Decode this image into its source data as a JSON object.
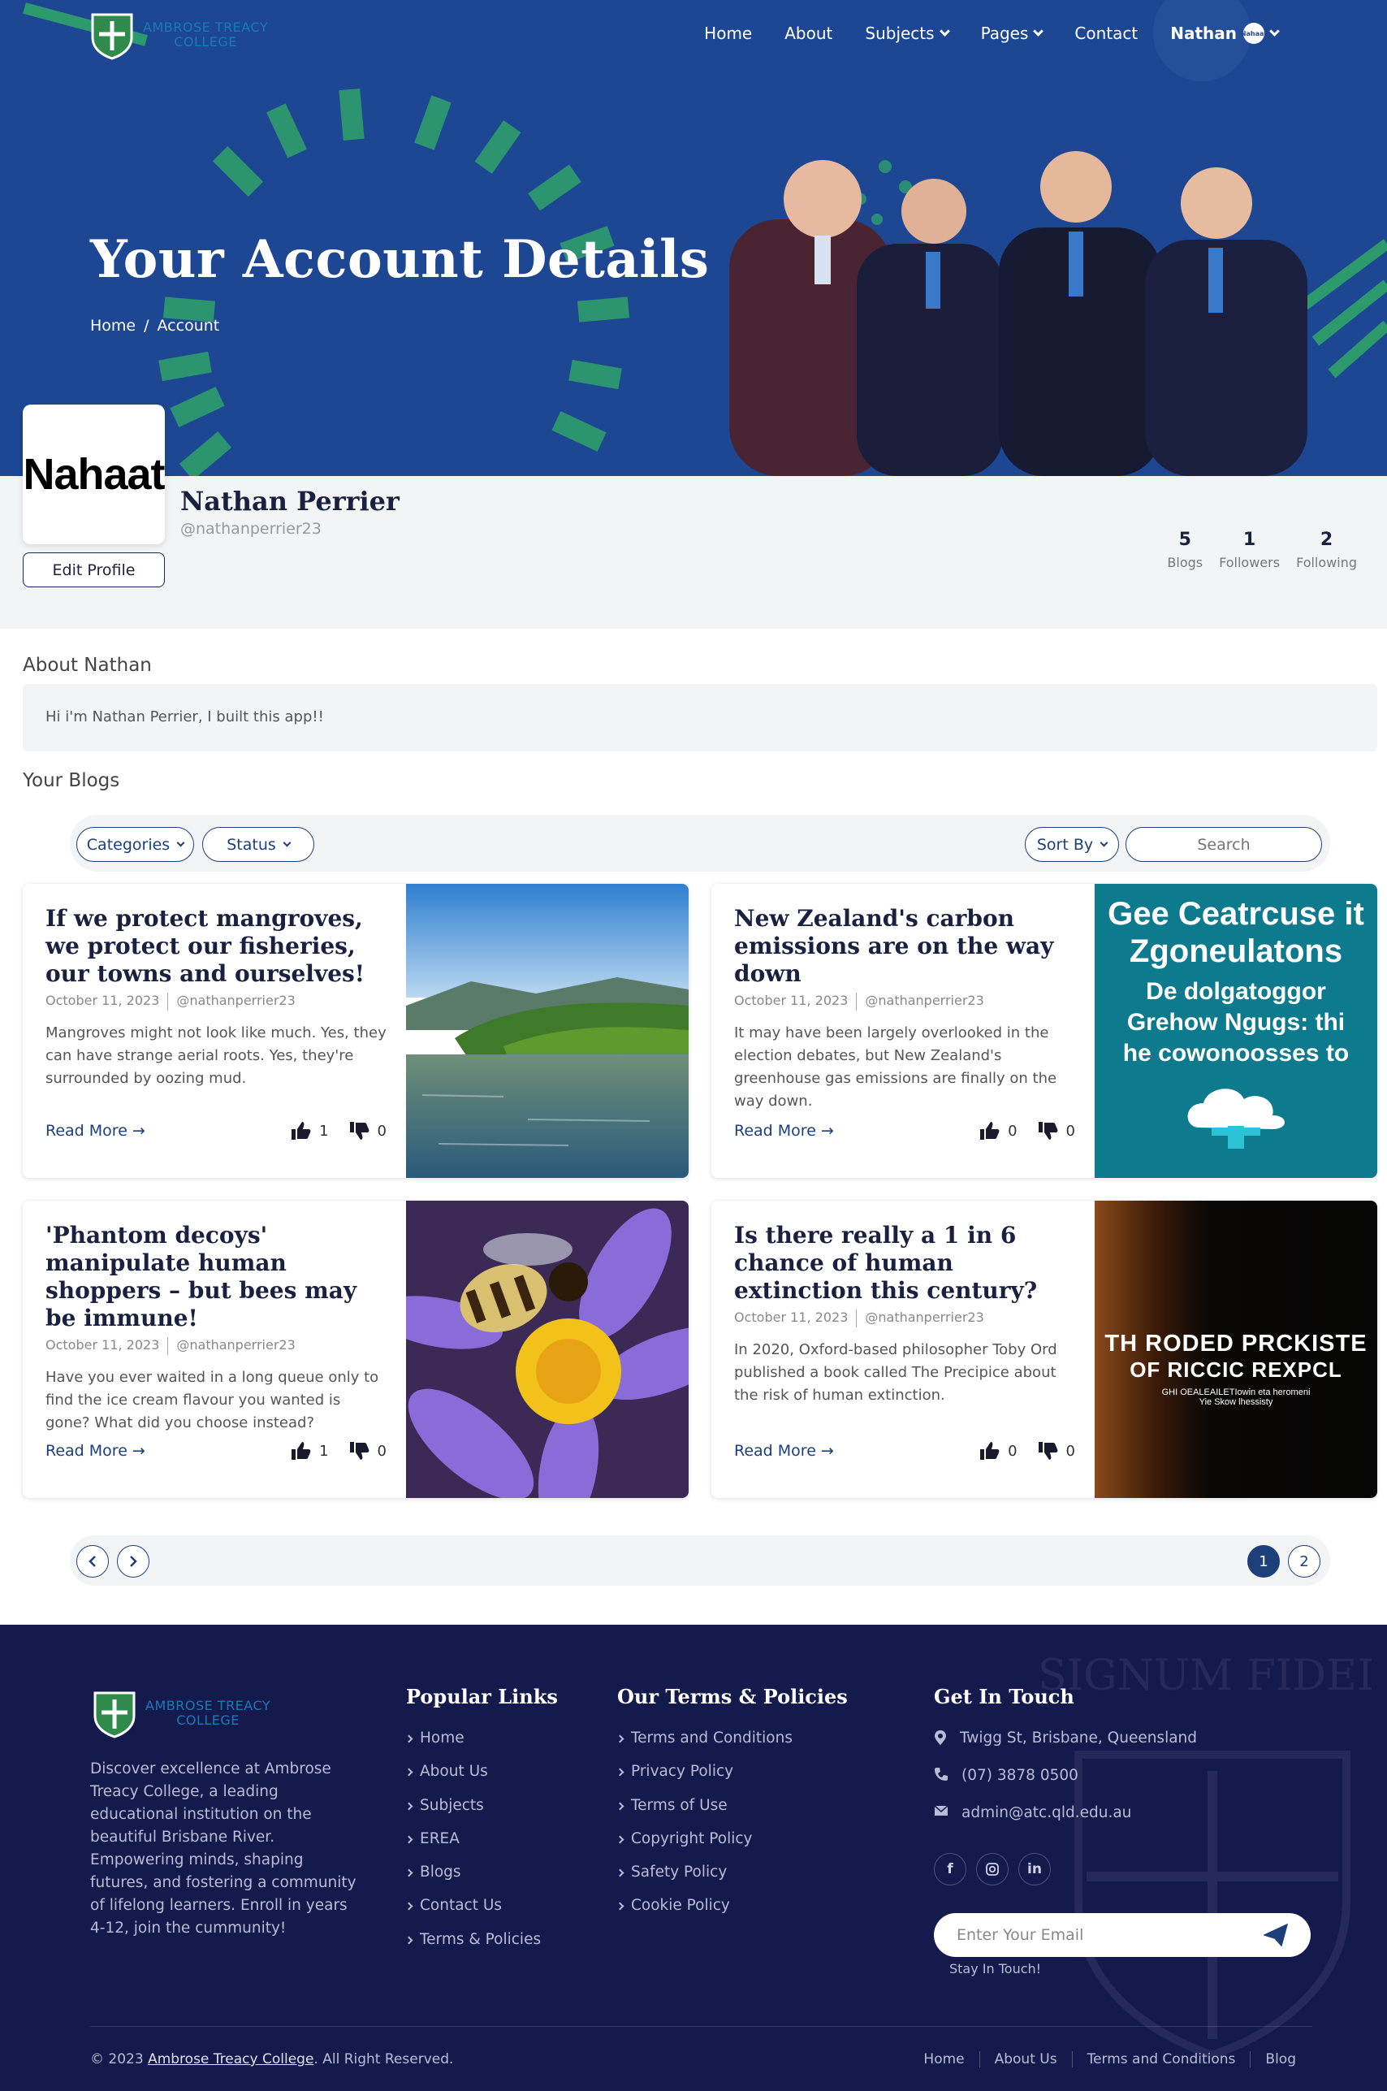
{
  "brand": {
    "logo_line1": "AMBROSE TREACY",
    "logo_line2": "COLLEGE"
  },
  "nav": {
    "items": [
      "Home",
      "About",
      "Subjects",
      "Pages",
      "Contact"
    ],
    "user": "Nathan",
    "user_avatar": "Nahaat"
  },
  "hero": {
    "title": "Your Account Details",
    "crumb_home": "Home",
    "crumb_sep": "/",
    "crumb_current": "Account"
  },
  "profile": {
    "avatar_text": "Nahaat",
    "name": "Nathan Perrier",
    "handle": "@nathanperrier23",
    "edit_label": "Edit Profile",
    "stats": [
      {
        "value": "5",
        "label": "Blogs"
      },
      {
        "value": "1",
        "label": "Followers"
      },
      {
        "value": "2",
        "label": "Following"
      }
    ]
  },
  "about": {
    "title": "About Nathan",
    "text": "Hi i'm Nathan Perrier, I built this app!!"
  },
  "blogs": {
    "title": "Your Blogs",
    "filters": {
      "categories": "Categories",
      "status": "Status",
      "sort": "Sort By",
      "search_placeholder": "Search"
    },
    "read_more": "Read More →",
    "posts": [
      {
        "title": "If we protect mangroves, we protect our fisheries, our towns and ourselves!",
        "date": "October 11, 2023",
        "author": "@nathanperrier23",
        "excerpt": "Mangroves might not look like much. Yes, they can have strange aerial roots. Yes, they're surrounded by oozing mud.",
        "likes": "1",
        "dislikes": "0"
      },
      {
        "title": "New Zealand's carbon emissions are on the way down",
        "date": "October 11, 2023",
        "author": "@nathanperrier23",
        "excerpt": "It may have been largely overlooked in the election debates, but New Zealand's greenhouse gas emissions are finally on the way down.",
        "likes": "0",
        "dislikes": "0",
        "image_text": [
          "Gee Ceatrcuse it",
          "Zgoneulatons",
          "De dolgatoggor",
          "Grehow Ngugs: thi",
          "he cowonoosses to"
        ]
      },
      {
        "title": "'Phantom decoys' manipulate human shoppers – but bees may be immune!",
        "date": "October 11, 2023",
        "author": "@nathanperrier23",
        "excerpt": "Have you ever waited in a long queue only to find the ice cream flavour you wanted is gone? What did you choose instead?",
        "likes": "1",
        "dislikes": "0"
      },
      {
        "title": "Is there really a 1 in 6 chance of human extinction this century?",
        "date": "October 11, 2023",
        "author": "@nathanperrier23",
        "excerpt": "In 2020, Oxford-based philosopher Toby Ord published a book called The Precipice about the risk of human extinction.",
        "likes": "0",
        "dislikes": "0",
        "image_text": [
          "TH RODED PRCKISTE",
          "OF RICCIC REXPCL",
          "GHI OEALEAILETIowin eta heromeni",
          "Yie Skow lhessisty"
        ]
      }
    ]
  },
  "pagination": {
    "pages": [
      "1",
      "2"
    ],
    "current": "1"
  },
  "footer": {
    "description": "Discover excellence at Ambrose Treacy College, a leading educational institution on the beautiful Brisbane River. Empowering minds, shaping futures, and fostering a community of lifelong learners. Enroll in years 4-12, join the cummunity!",
    "popular_title": "Popular Links",
    "popular_links": [
      "Home",
      "About Us",
      "Subjects",
      "EREA",
      "Blogs",
      "Contact Us",
      "Terms & Policies"
    ],
    "terms_title": "Our Terms & Policies",
    "terms_links": [
      "Terms and Conditions",
      "Privacy Policy",
      "Terms of Use",
      "Copyright Policy",
      "Safety Policy",
      "Cookie Policy"
    ],
    "contact_title": "Get In Touch",
    "address": "Twigg St, Brisbane, Queensland",
    "phone": "(07) 3878 0500",
    "email": "admin@atc.qld.edu.au",
    "email_placeholder": "Enter Your Email",
    "stay_label": "Stay In Touch!",
    "copyright_prefix": "© 2023",
    "copyright_link": "Ambrose Treacy College",
    "copyright_suffix": ". All Right Reserved.",
    "bottom_links": [
      "Home",
      "About Us",
      "Terms and Conditions",
      "Blog"
    ],
    "crest_text": "SIGNUM FIDEI"
  },
  "colors": {
    "primary": "#1d4793",
    "footer_bg": "#151a4d",
    "accent_green": "#2fa36b",
    "button_blue": "#1d3f7a"
  }
}
